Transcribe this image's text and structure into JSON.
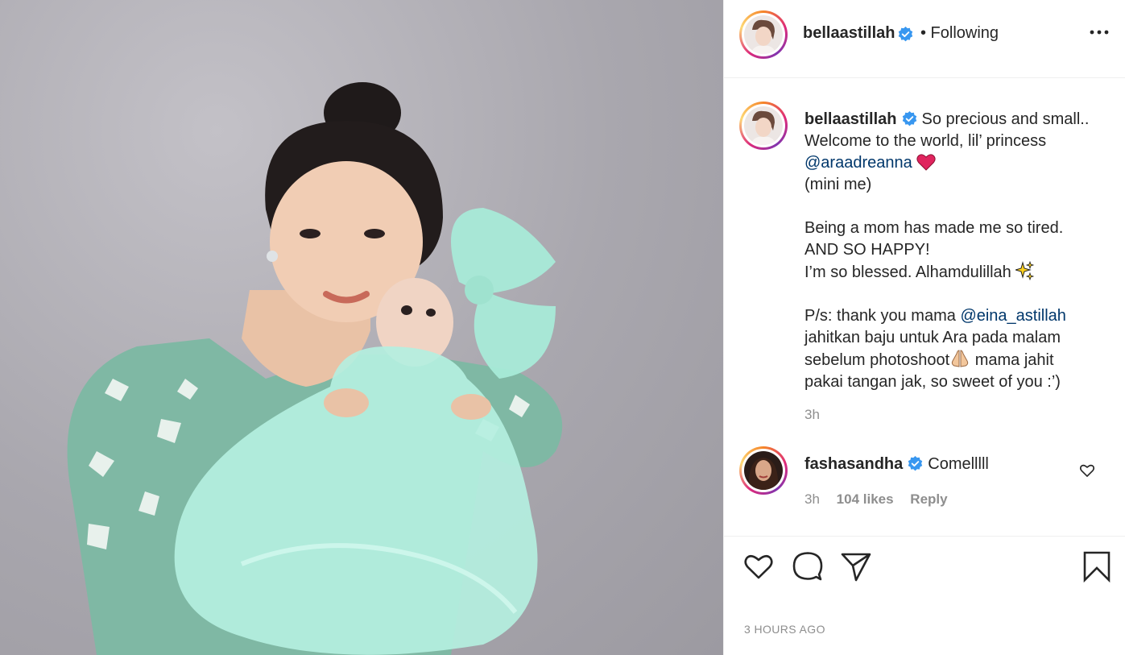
{
  "post": {
    "author": "bellaastillah",
    "follow_status": "• Following",
    "caption": {
      "username": "bellaastillah",
      "line1": "So precious and small..",
      "line2": "Welcome to the world, lil’ princess",
      "mention1": "@araadreanna",
      "line3": "(mini me)",
      "line4": "Being a mom has made me so tired.",
      "line5": "AND SO HAPPY!",
      "line6": "I’m so blessed. Alhamdulillah",
      "line7_prefix": "P/s: thank you mama",
      "mention2": "@eina_astillah",
      "line8": "jahitkan baju untuk Ara pada malam",
      "line9": "sebelum photoshoot",
      "line9_suffix": " mama jahit",
      "line10": "pakai tangan jak, so sweet of you :’)",
      "time": "3h"
    },
    "comment": {
      "username": "fashasandha",
      "text": "Comelllll",
      "time": "3h",
      "likes": "104 likes",
      "reply": "Reply"
    },
    "timestamp": "3 HOURS AGO"
  },
  "colors": {
    "verified": "#3897f0",
    "mention": "#00376b",
    "heart_emoji": "#e0245e"
  },
  "icons": [
    "verified-badge-icon",
    "more-options-icon",
    "heart-icon",
    "comment-icon",
    "share-icon",
    "bookmark-icon"
  ]
}
